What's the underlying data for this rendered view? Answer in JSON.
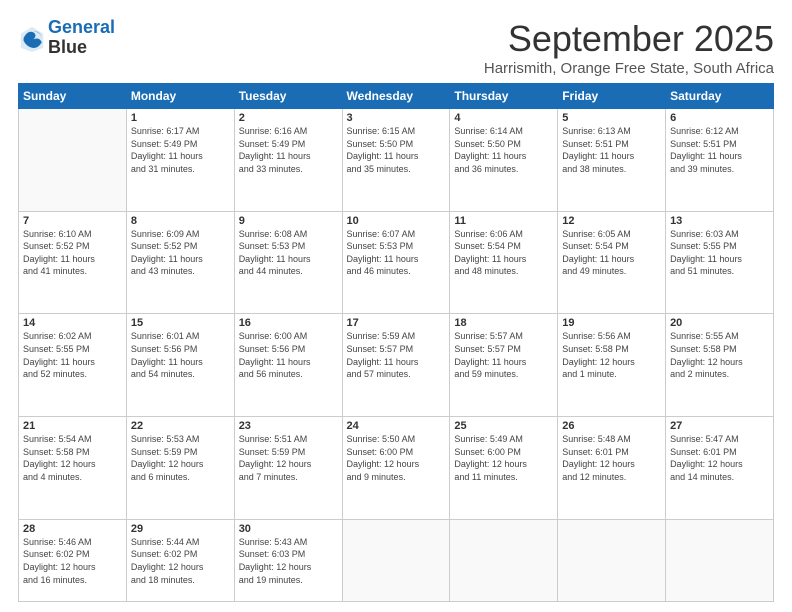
{
  "logo": {
    "line1": "General",
    "line2": "Blue"
  },
  "title": "September 2025",
  "subtitle": "Harrismith, Orange Free State, South Africa",
  "days": [
    "Sunday",
    "Monday",
    "Tuesday",
    "Wednesday",
    "Thursday",
    "Friday",
    "Saturday"
  ],
  "weeks": [
    [
      {
        "num": "",
        "info": ""
      },
      {
        "num": "1",
        "info": "Sunrise: 6:17 AM\nSunset: 5:49 PM\nDaylight: 11 hours\nand 31 minutes."
      },
      {
        "num": "2",
        "info": "Sunrise: 6:16 AM\nSunset: 5:49 PM\nDaylight: 11 hours\nand 33 minutes."
      },
      {
        "num": "3",
        "info": "Sunrise: 6:15 AM\nSunset: 5:50 PM\nDaylight: 11 hours\nand 35 minutes."
      },
      {
        "num": "4",
        "info": "Sunrise: 6:14 AM\nSunset: 5:50 PM\nDaylight: 11 hours\nand 36 minutes."
      },
      {
        "num": "5",
        "info": "Sunrise: 6:13 AM\nSunset: 5:51 PM\nDaylight: 11 hours\nand 38 minutes."
      },
      {
        "num": "6",
        "info": "Sunrise: 6:12 AM\nSunset: 5:51 PM\nDaylight: 11 hours\nand 39 minutes."
      }
    ],
    [
      {
        "num": "7",
        "info": "Sunrise: 6:10 AM\nSunset: 5:52 PM\nDaylight: 11 hours\nand 41 minutes."
      },
      {
        "num": "8",
        "info": "Sunrise: 6:09 AM\nSunset: 5:52 PM\nDaylight: 11 hours\nand 43 minutes."
      },
      {
        "num": "9",
        "info": "Sunrise: 6:08 AM\nSunset: 5:53 PM\nDaylight: 11 hours\nand 44 minutes."
      },
      {
        "num": "10",
        "info": "Sunrise: 6:07 AM\nSunset: 5:53 PM\nDaylight: 11 hours\nand 46 minutes."
      },
      {
        "num": "11",
        "info": "Sunrise: 6:06 AM\nSunset: 5:54 PM\nDaylight: 11 hours\nand 48 minutes."
      },
      {
        "num": "12",
        "info": "Sunrise: 6:05 AM\nSunset: 5:54 PM\nDaylight: 11 hours\nand 49 minutes."
      },
      {
        "num": "13",
        "info": "Sunrise: 6:03 AM\nSunset: 5:55 PM\nDaylight: 11 hours\nand 51 minutes."
      }
    ],
    [
      {
        "num": "14",
        "info": "Sunrise: 6:02 AM\nSunset: 5:55 PM\nDaylight: 11 hours\nand 52 minutes."
      },
      {
        "num": "15",
        "info": "Sunrise: 6:01 AM\nSunset: 5:56 PM\nDaylight: 11 hours\nand 54 minutes."
      },
      {
        "num": "16",
        "info": "Sunrise: 6:00 AM\nSunset: 5:56 PM\nDaylight: 11 hours\nand 56 minutes."
      },
      {
        "num": "17",
        "info": "Sunrise: 5:59 AM\nSunset: 5:57 PM\nDaylight: 11 hours\nand 57 minutes."
      },
      {
        "num": "18",
        "info": "Sunrise: 5:57 AM\nSunset: 5:57 PM\nDaylight: 11 hours\nand 59 minutes."
      },
      {
        "num": "19",
        "info": "Sunrise: 5:56 AM\nSunset: 5:58 PM\nDaylight: 12 hours\nand 1 minute."
      },
      {
        "num": "20",
        "info": "Sunrise: 5:55 AM\nSunset: 5:58 PM\nDaylight: 12 hours\nand 2 minutes."
      }
    ],
    [
      {
        "num": "21",
        "info": "Sunrise: 5:54 AM\nSunset: 5:58 PM\nDaylight: 12 hours\nand 4 minutes."
      },
      {
        "num": "22",
        "info": "Sunrise: 5:53 AM\nSunset: 5:59 PM\nDaylight: 12 hours\nand 6 minutes."
      },
      {
        "num": "23",
        "info": "Sunrise: 5:51 AM\nSunset: 5:59 PM\nDaylight: 12 hours\nand 7 minutes."
      },
      {
        "num": "24",
        "info": "Sunrise: 5:50 AM\nSunset: 6:00 PM\nDaylight: 12 hours\nand 9 minutes."
      },
      {
        "num": "25",
        "info": "Sunrise: 5:49 AM\nSunset: 6:00 PM\nDaylight: 12 hours\nand 11 minutes."
      },
      {
        "num": "26",
        "info": "Sunrise: 5:48 AM\nSunset: 6:01 PM\nDaylight: 12 hours\nand 12 minutes."
      },
      {
        "num": "27",
        "info": "Sunrise: 5:47 AM\nSunset: 6:01 PM\nDaylight: 12 hours\nand 14 minutes."
      }
    ],
    [
      {
        "num": "28",
        "info": "Sunrise: 5:46 AM\nSunset: 6:02 PM\nDaylight: 12 hours\nand 16 minutes."
      },
      {
        "num": "29",
        "info": "Sunrise: 5:44 AM\nSunset: 6:02 PM\nDaylight: 12 hours\nand 18 minutes."
      },
      {
        "num": "30",
        "info": "Sunrise: 5:43 AM\nSunset: 6:03 PM\nDaylight: 12 hours\nand 19 minutes."
      },
      {
        "num": "",
        "info": ""
      },
      {
        "num": "",
        "info": ""
      },
      {
        "num": "",
        "info": ""
      },
      {
        "num": "",
        "info": ""
      }
    ]
  ]
}
